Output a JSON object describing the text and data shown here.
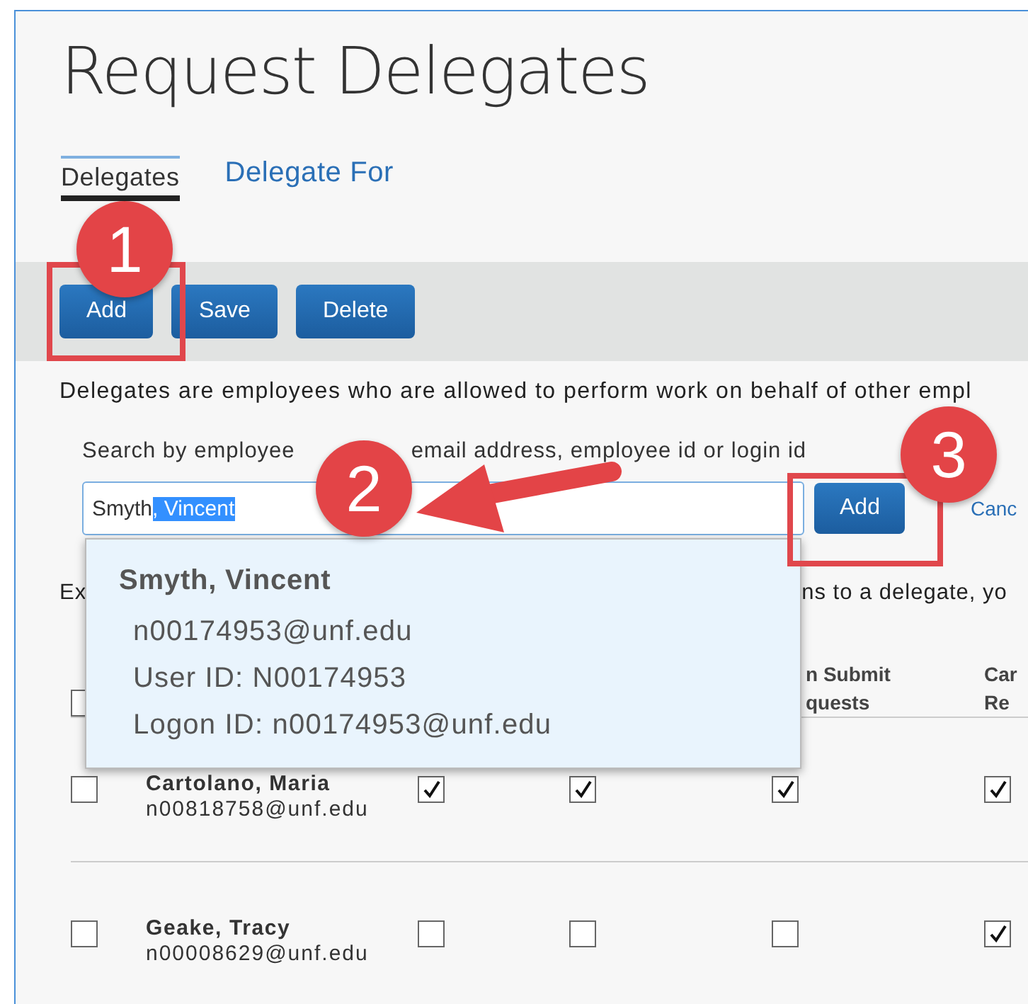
{
  "title": "Request Delegates",
  "tabs": [
    {
      "label": "Delegates",
      "selected": true
    },
    {
      "label": "Delegate For",
      "selected": false
    }
  ],
  "toolbar": {
    "buttons": [
      "Add",
      "Save",
      "Delete"
    ]
  },
  "description": "Delegates are employees who are allowed to perform work on behalf of other empl",
  "search": {
    "label_start": "Search by employee",
    "label_end": "email address, employee id or login id",
    "value_plain": "Smyth",
    "value_selected": ", Vincent",
    "add_button": "Add",
    "cancel_link": "Canc"
  },
  "suggestion": {
    "name": "Smyth, Vincent",
    "lines": [
      "n00174953@unf.edu",
      "User ID: N00174953",
      "Logon ID: n00174953@unf.edu"
    ]
  },
  "note": {
    "start": "Ex",
    "end": "ns to a delegate, yo"
  },
  "table": {
    "header_checkbox": {
      "checked": false
    },
    "columns": [
      {
        "lines": [
          "n Submit",
          "quests"
        ]
      },
      {
        "lines": [
          "Car",
          "Re"
        ]
      }
    ],
    "rows": [
      {
        "selected": false,
        "name": "Cartolano, Maria",
        "email": "n00818758@unf.edu",
        "permissions": [
          true,
          true,
          true,
          true
        ]
      },
      {
        "selected": false,
        "name": "Geake, Tracy",
        "email": "n00008629@unf.edu",
        "permissions": [
          false,
          false,
          false,
          true
        ]
      }
    ]
  },
  "annotations": [
    {
      "number": "1"
    },
    {
      "number": "2"
    },
    {
      "number": "3"
    }
  ]
}
